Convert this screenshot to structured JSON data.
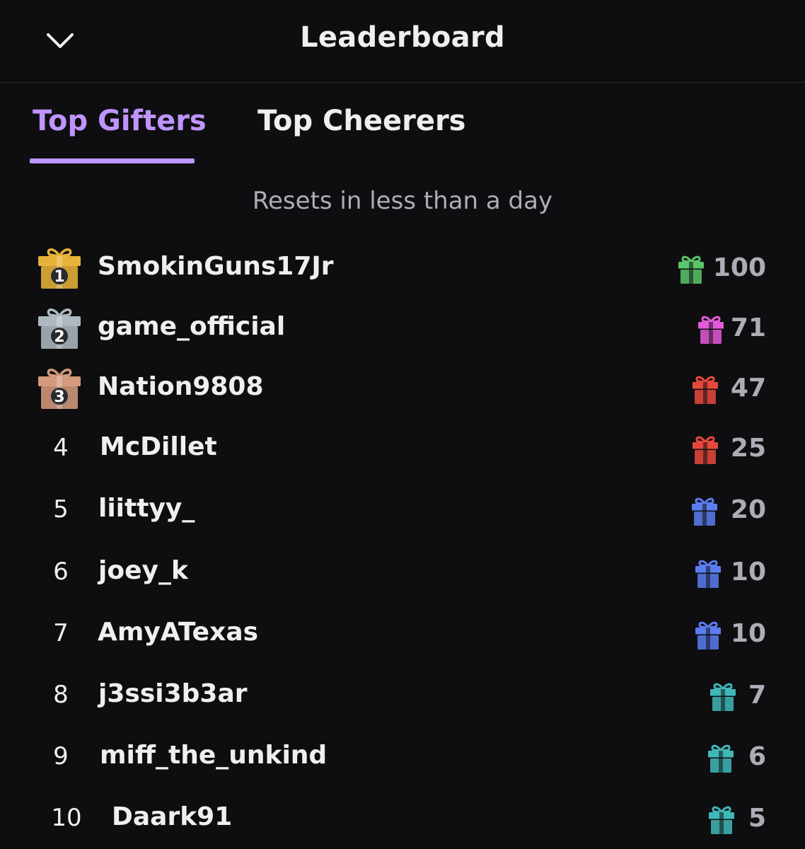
{
  "header": {
    "title": "Leaderboard",
    "collapse_icon": "chevron-down-icon"
  },
  "tabs": [
    {
      "label": "Top Gifters",
      "active": true
    },
    {
      "label": "Top Cheerers",
      "active": false
    }
  ],
  "accent_color": "#bf94ff",
  "resets_text": "Resets in less than a day",
  "rows": [
    {
      "rank": "1",
      "name": "SmokinGuns17Jr",
      "count": "100",
      "gift_color": "#5ac66a",
      "badge": "gold-gift-badge-icon",
      "badge_color": "#e6b33a"
    },
    {
      "rank": "2",
      "name": "game_official",
      "count": "71",
      "gift_color": "#e45ad8",
      "badge": "silver-gift-badge-icon",
      "badge_color": "#aeb8c0"
    },
    {
      "rank": "3",
      "name": "Nation9808",
      "count": "47",
      "gift_color": "#e8483c",
      "badge": "bronze-gift-badge-icon",
      "badge_color": "#d39a7c"
    },
    {
      "rank": "4",
      "name": "McDillet",
      "count": "25",
      "gift_color": "#e8483c"
    },
    {
      "rank": "5",
      "name": "liittyy_",
      "count": "20",
      "gift_color": "#5b7df0"
    },
    {
      "rank": "6",
      "name": "joey_k",
      "count": "10",
      "gift_color": "#5b7df0"
    },
    {
      "rank": "7",
      "name": "AmyATexas",
      "count": "10",
      "gift_color": "#5b7df0"
    },
    {
      "rank": "8",
      "name": "j3ssi3b3ar",
      "count": "7",
      "gift_color": "#3fb8b8"
    },
    {
      "rank": "9",
      "name": "miff_the_unkind",
      "count": "6",
      "gift_color": "#3fb8b8"
    },
    {
      "rank": "10",
      "name": "Daark91",
      "count": "5",
      "gift_color": "#3fb8b8"
    }
  ]
}
